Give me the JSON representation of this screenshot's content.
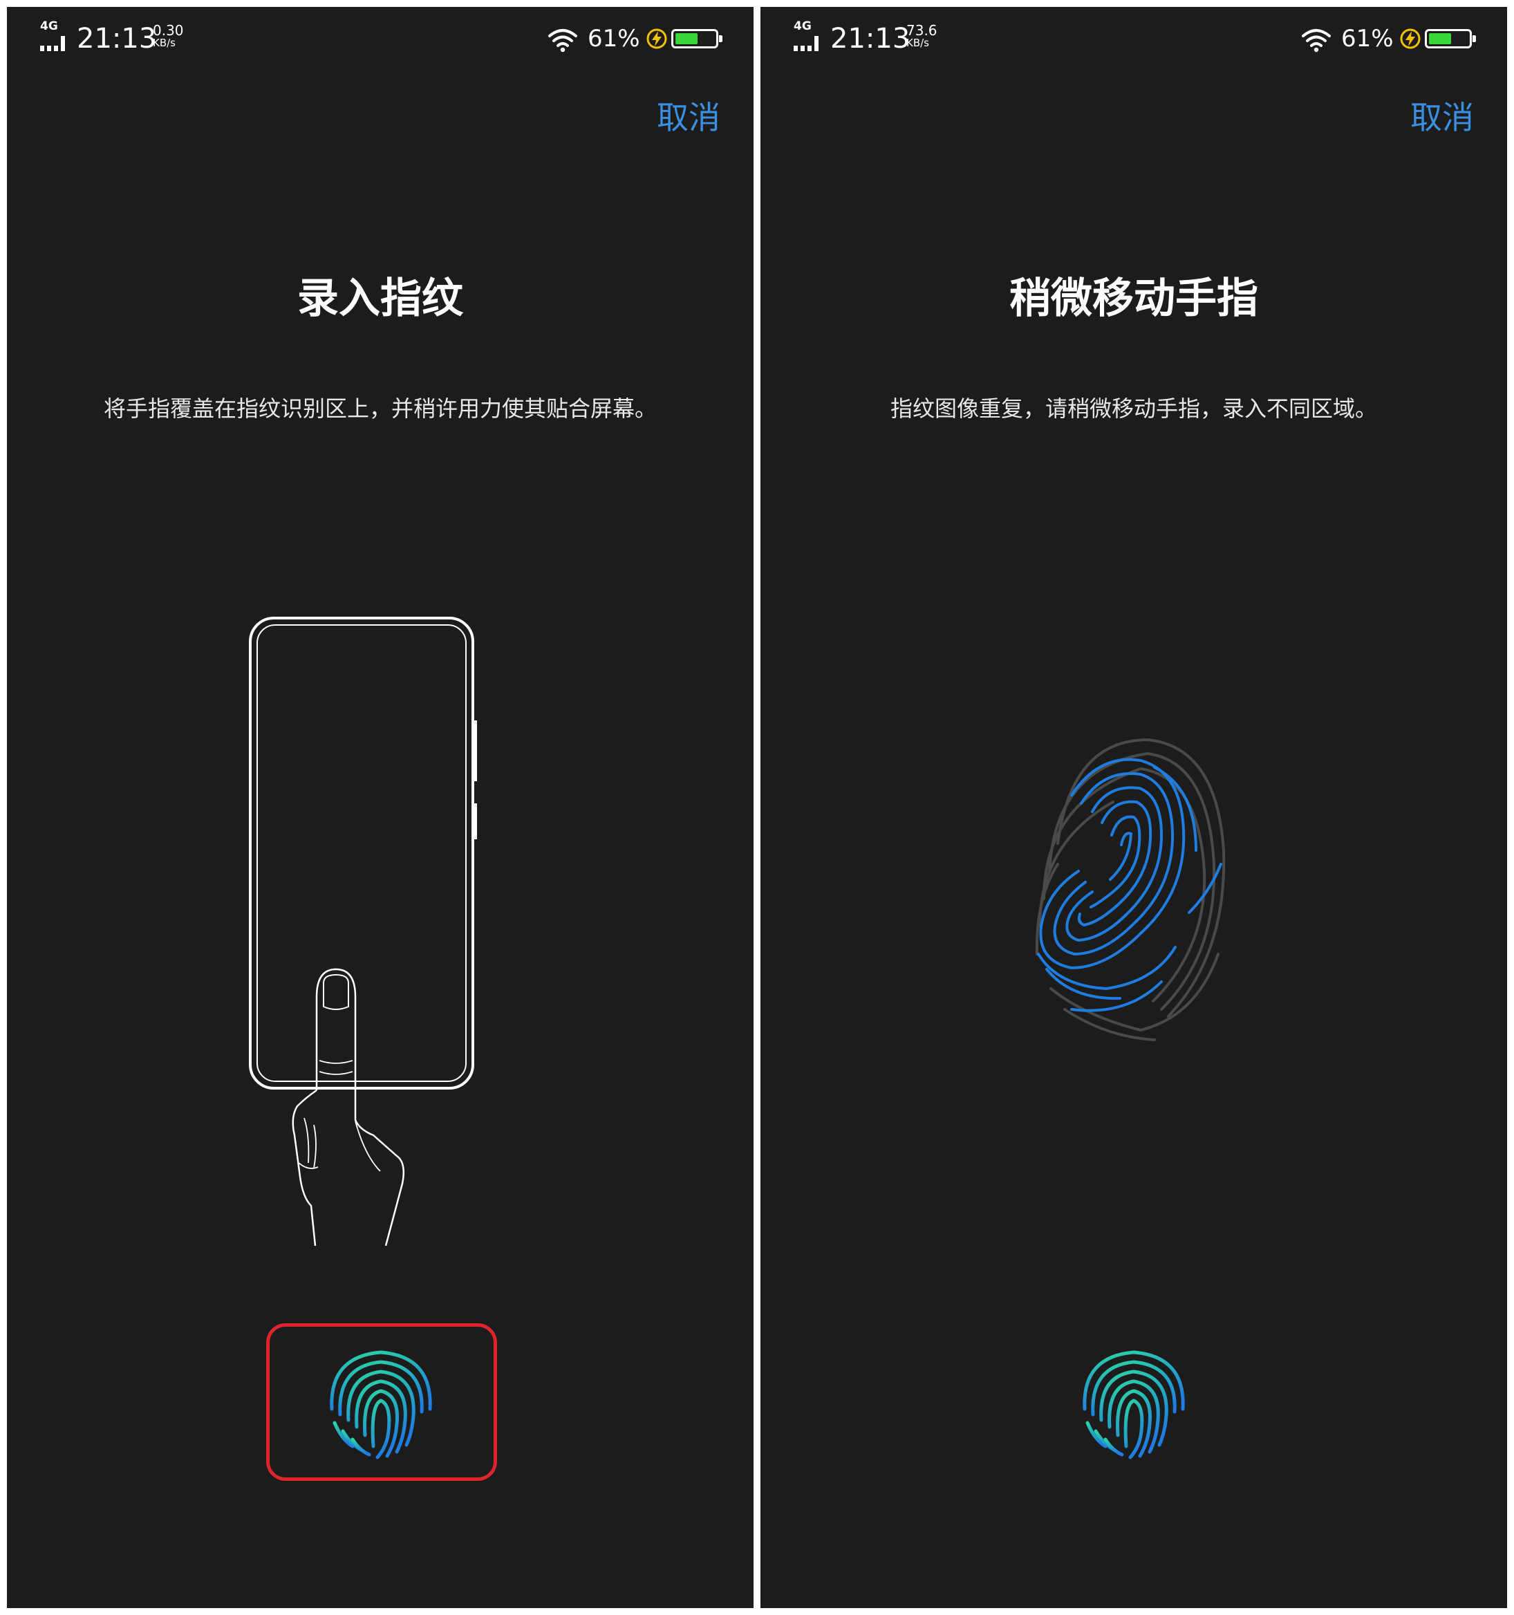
{
  "screens": [
    {
      "status": {
        "network": "4G",
        "time": "21:13",
        "speed_value": "0.30",
        "speed_unit": "KB/s",
        "battery_percent": "61%",
        "battery_level": 0.61
      },
      "cancel_label": "取消",
      "title": "录入指纹",
      "description": "将手指覆盖在指纹识别区上，并稍许用力使其贴合屏幕。"
    },
    {
      "status": {
        "network": "4G",
        "time": "21:13",
        "speed_value": "73.6",
        "speed_unit": "KB/s",
        "battery_percent": "61%",
        "battery_level": 0.61
      },
      "cancel_label": "取消",
      "title": "稍微移动手指",
      "description": "指纹图像重复，请稍微移动手指，录入不同区域。"
    }
  ],
  "colors": {
    "background": "#1c1c1c",
    "accent": "#3a8fe0",
    "highlight_frame": "#e0232d",
    "fingerprint_teal": "#2bd4a5",
    "fingerprint_blue": "#1f7de0",
    "battery_fill": "#3ad63a",
    "charge_bolt": "#f2c200"
  },
  "icons": {
    "signal": "signal-icon",
    "wifi": "wifi-icon",
    "charging": "charging-bolt-icon",
    "battery": "battery-icon",
    "fingerprint": "fingerprint-icon"
  }
}
